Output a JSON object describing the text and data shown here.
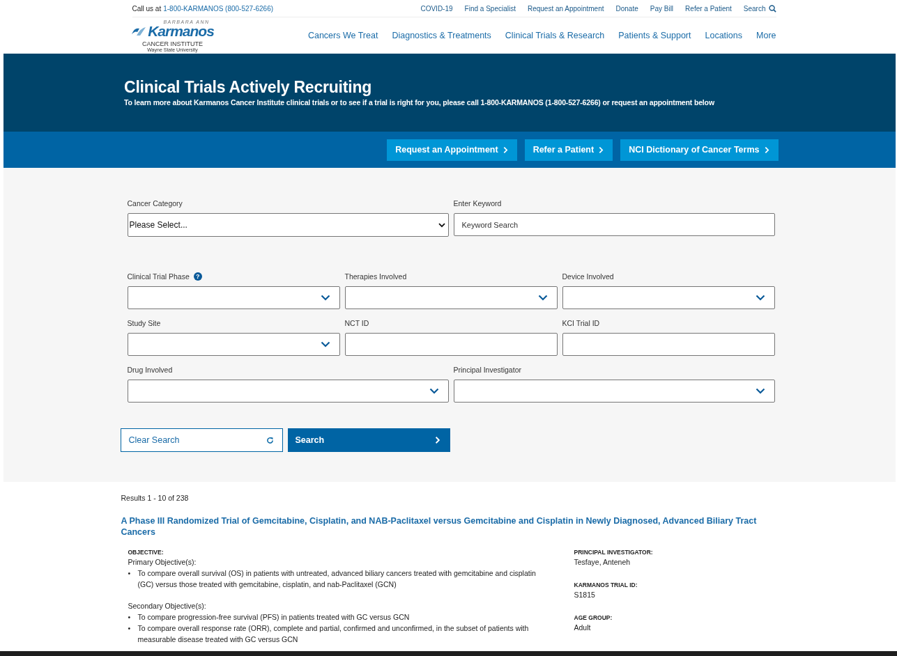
{
  "top_bar": {
    "call_label": "Call us at",
    "phone": "1-800-KARMANOS (800-527-6266)",
    "links": [
      "COVID-19",
      "Find a Specialist",
      "Request an Appointment",
      "Donate",
      "Pay Bill",
      "Refer a Patient"
    ],
    "search": "Search"
  },
  "logo": {
    "overline": "BARBARA ANN",
    "name": "Karmanos",
    "subtitle": "CANCER INSTITUTE",
    "affiliation": "Wayne State University"
  },
  "main_nav": [
    "Cancers We Treat",
    "Diagnostics & Treatments",
    "Clinical Trials & Research",
    "Patients & Support",
    "Locations",
    "More"
  ],
  "hero": {
    "title": "Clinical Trials Actively Recruiting",
    "description": "To learn more about Karmanos Cancer Institute clinical trials or to see if a trial is right for you, please call **1-800-KARMANOS (1-800-527-6266)** or request an appointment below"
  },
  "actions": [
    "Request an Appointment",
    "Refer a Patient",
    "NCI Dictionary of Cancer Terms"
  ],
  "filters": [
    [
      {
        "kind": "native-select",
        "label": "Cancer Category",
        "value": "Please Select..."
      },
      {
        "kind": "text",
        "label": "Enter Keyword",
        "placeholder": "Keyword Search"
      }
    ],
    [
      {
        "kind": "dropdown",
        "label": "Clinical Trial Phase",
        "help": "?"
      },
      {
        "kind": "dropdown",
        "label": "Therapies Involved"
      },
      {
        "kind": "dropdown",
        "label": "Device Involved"
      }
    ],
    [
      {
        "kind": "dropdown",
        "label": "Study Site"
      },
      {
        "kind": "text",
        "label": "NCT ID"
      },
      {
        "kind": "text",
        "label": "KCI Trial ID"
      }
    ],
    [
      {
        "kind": "dropdown",
        "label": "Drug Involved"
      },
      {
        "kind": "dropdown",
        "label": "Principal Investigator"
      }
    ]
  ],
  "form_buttons": {
    "clear": "Clear Search",
    "search": "Search"
  },
  "results": {
    "summary": "Results 1 - 10 of 238",
    "trials": [
      {
        "title": "A Phase III Randomized Trial of Gemcitabine, Cisplatin, and NAB-Paclitaxel versus Gemcitabine and Cisplatin in Newly Diagnosed, Advanced Biliary Tract Cancers",
        "objective_label": "OBJECTIVE:",
        "bullet": "•",
        "sections": [
          {
            "heading": "Primary Objective(s):",
            "bullets": [
              "To compare overall survival (OS) in patients with untreated, advanced biliary cancers treated with gemcitabine and cisplatin (GC) versus those treated with gemcitabine, cisplatin, and nab-Paclitaxel (GCN)"
            ]
          },
          {
            "heading": "Secondary Objective(s):",
            "bullets": [
              "To compare progression-free survival (PFS) in patients treated with GC versus GCN",
              "To compare overall response rate (ORR), complete and partial, confirmed and unconfirmed, in the subset of patients with measurable disease treated with GC versus GCN"
            ]
          }
        ],
        "details": [
          {
            "label": "PRINCIPAL INVESTIGATOR:",
            "value": "Tesfaye, Anteneh"
          },
          {
            "label": "KARMANOS TRIAL ID:",
            "value": "S1815"
          },
          {
            "label": "AGE GROUP:",
            "value": "Adult"
          }
        ]
      }
    ]
  }
}
